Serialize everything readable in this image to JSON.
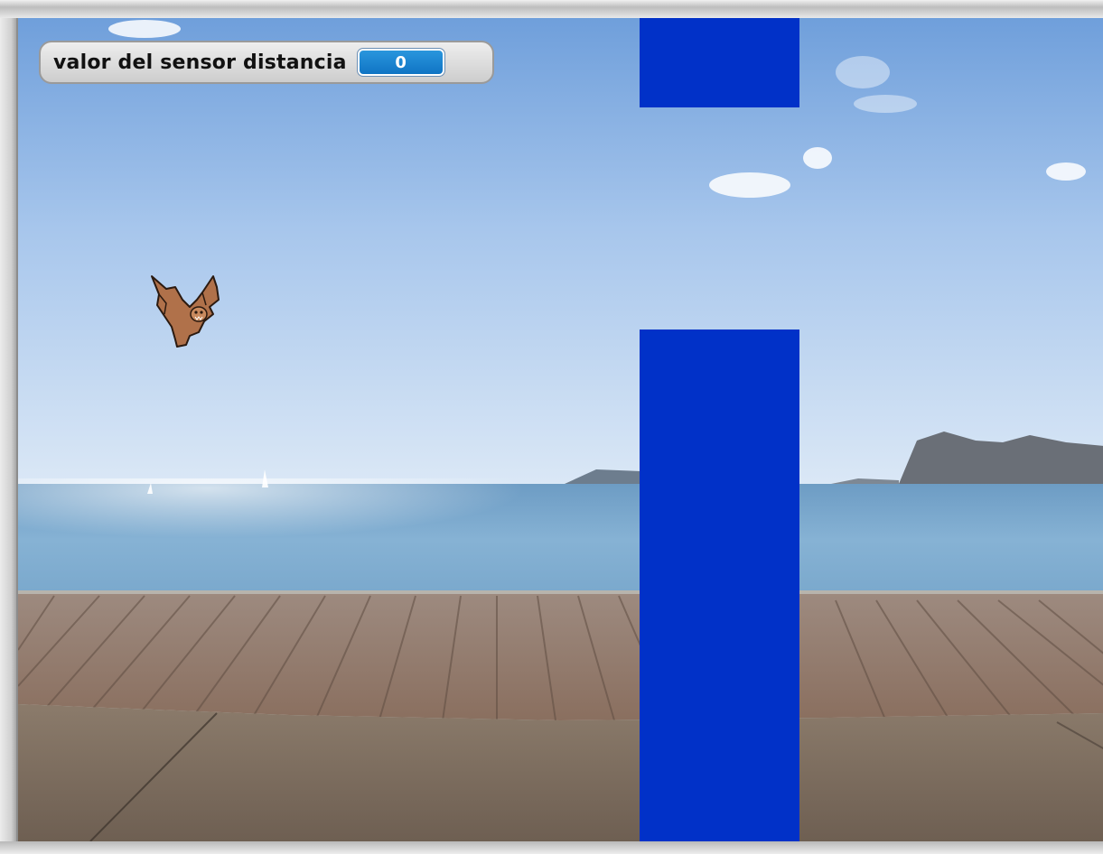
{
  "stage": {
    "variable_monitor": {
      "label": "valor del sensor distancia",
      "value": "0"
    },
    "sprites": {
      "player": "bat",
      "obstacles": [
        "pipe-top",
        "pipe-bottom"
      ]
    },
    "colors": {
      "pipe": "#0131c8",
      "monitor_value_bg": "#1a85d2"
    }
  }
}
